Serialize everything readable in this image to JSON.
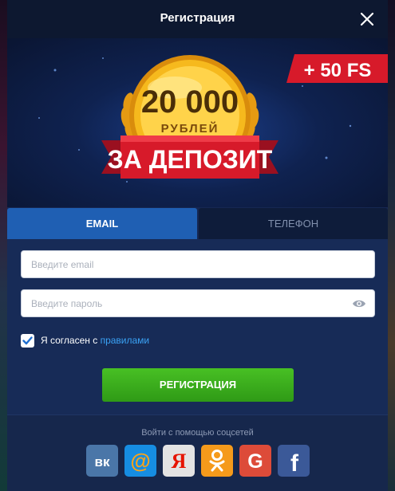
{
  "dialog": {
    "title": "Регистрация",
    "close_icon": "close-icon"
  },
  "banner": {
    "bonus_badge": "+ 50 FS",
    "amount": "20 000",
    "currency": "РУБЛЕЙ",
    "ribbon": "ЗА ДЕПОЗИТ"
  },
  "tabs": [
    {
      "label": "EMAIL",
      "active": true
    },
    {
      "label": "ТЕЛЕФОН",
      "active": false
    }
  ],
  "form": {
    "email": {
      "value": "",
      "placeholder": "Введите email"
    },
    "password": {
      "value": "",
      "placeholder": "Введите пароль",
      "icon": "eye-icon"
    },
    "agree": {
      "checked": true,
      "text": "Я согласен с ",
      "link": "правилами"
    },
    "submit_label": "РЕГИСТРАЦИЯ"
  },
  "social": {
    "title": "Войти с помощью соцсетей",
    "buttons": [
      {
        "icon": "vk-icon",
        "glyph": "вк",
        "color": "#4a76a8"
      },
      {
        "icon": "mailru-icon",
        "glyph": "@",
        "color": "#168de2"
      },
      {
        "icon": "yandex-icon",
        "glyph": "Я",
        "color": "#d8d8d8"
      },
      {
        "icon": "odnoklassniki-icon",
        "glyph": "ок",
        "color": "#f59a1b"
      },
      {
        "icon": "google-icon",
        "glyph": "G",
        "color": "#dd4b39"
      },
      {
        "icon": "facebook-icon",
        "glyph": "f",
        "color": "#3b5998"
      }
    ]
  },
  "colors": {
    "accent_tab": "#1f5fb3",
    "button_green": "#3aab1d",
    "link": "#3aa2f5",
    "ribbon_red": "#d71a2a",
    "coin_gold": "#f2b51a"
  }
}
